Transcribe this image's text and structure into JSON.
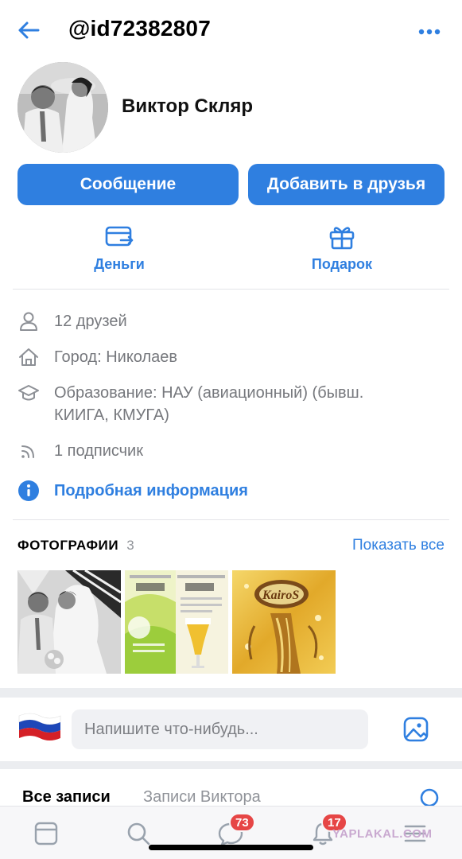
{
  "header": {
    "title": "@id72382807",
    "back_icon": "arrow-left-icon",
    "more_icon": "more-horizontal-icon"
  },
  "profile": {
    "name": "Виктор Скляр"
  },
  "buttons": {
    "message": "Сообщение",
    "add_friend": "Добавить в друзья"
  },
  "actions": {
    "money": "Деньги",
    "gift": "Подарок"
  },
  "info": {
    "friends": "12 друзей",
    "city": "Город: Николаев",
    "education": "Образование: НАУ (авиационный) (бывш. КИИГА, КМУГА)",
    "followers": "1 подписчик",
    "details_link": "Подробная информация"
  },
  "photos": {
    "title": "ФОТОГРАФИИ",
    "count": "3",
    "show_all": "Показать все"
  },
  "composer": {
    "placeholder": "Напишите что-нибудь..."
  },
  "wall_tabs": {
    "all": "Все записи",
    "owner": "Записи Виктора"
  },
  "tabbar": {
    "messages_badge": "73",
    "notifications_badge": "17"
  },
  "watermark": "YAPLAKAL.COM",
  "colors": {
    "accent": "#2f7fe0",
    "badge": "#e64646",
    "secondary_text": "#76787d"
  }
}
